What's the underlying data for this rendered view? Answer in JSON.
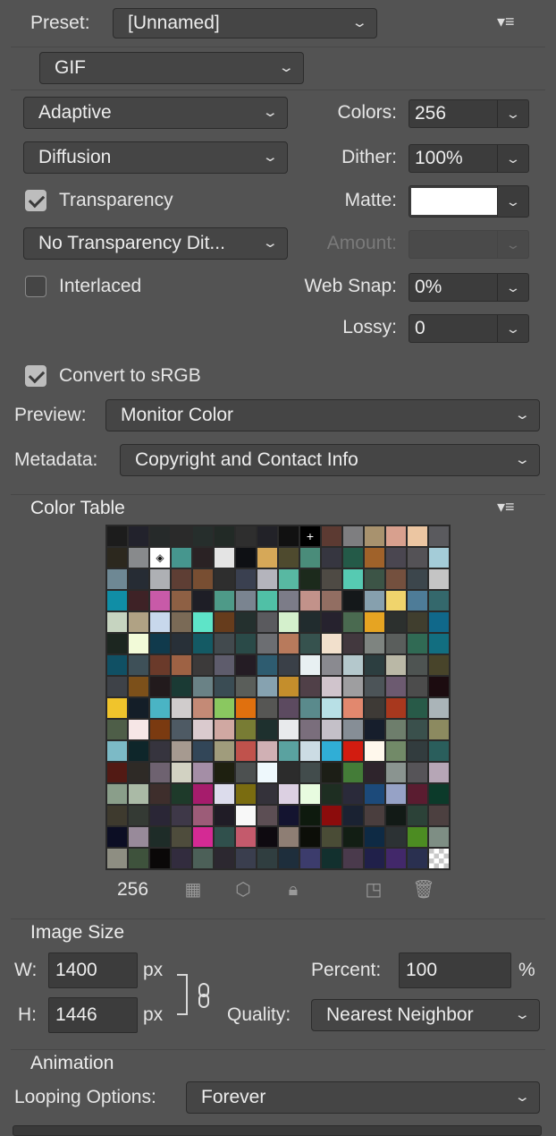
{
  "preset": {
    "label": "Preset:",
    "value": "[Unnamed]"
  },
  "format": {
    "value": "GIF"
  },
  "reduction": {
    "value": "Adaptive"
  },
  "dither_algorithm": {
    "value": "Diffusion"
  },
  "colors": {
    "label": "Colors:",
    "value": "256"
  },
  "dither": {
    "label": "Dither:",
    "value": "100%"
  },
  "transparency": {
    "label": "Transparency",
    "checked": true
  },
  "matte": {
    "label": "Matte:",
    "color": "#ffffff"
  },
  "transparency_dither": {
    "value": "No Transparency Dit..."
  },
  "amount": {
    "label": "Amount:",
    "value": ""
  },
  "interlaced": {
    "label": "Interlaced",
    "checked": false
  },
  "web_snap": {
    "label": "Web Snap:",
    "value": "0%"
  },
  "lossy": {
    "label": "Lossy:",
    "value": "0"
  },
  "convert_srgb": {
    "label": "Convert to sRGB",
    "checked": true
  },
  "preview": {
    "label": "Preview:",
    "value": "Monitor Color"
  },
  "metadata": {
    "label": "Metadata:",
    "value": "Copyright and Contact Info"
  },
  "color_table": {
    "title": "Color Table",
    "count": "256",
    "colors": [
      "#1c1c1c",
      "#22222c",
      "#262a2a",
      "#2a2a2a",
      "#262e2c",
      "#222a26",
      "#2e2e2e",
      "#222228",
      "#111111",
      "#141414",
      "#5c3a32",
      "#7e7e80",
      "#a8926e",
      "#d8a08e",
      "#ecc6a2",
      "#5a5a5e",
      "#2c281e",
      "#888a8c",
      "#ffffff",
      "#46968e",
      "#2a2224",
      "#e4e4e4",
      "#0e1014",
      "#d6a858",
      "#4e4a2e",
      "#4a8c7a",
      "#363640",
      "#245a48",
      "#a0622a",
      "#4a4650",
      "#545256",
      "#a4ccd8",
      "#6e8894",
      "#262c34",
      "#aeb0b4",
      "#5e3e34",
      "#784e32",
      "#2e2e2e",
      "#3a4050",
      "#b4b4bc",
      "#58b8a2",
      "#1c2a1c",
      "#4e4a44",
      "#56cab2",
      "#3c5446",
      "#74503e",
      "#3c464c",
      "#c4c4c4",
      "#108ea6",
      "#3e2226",
      "#c85aa8",
      "#8e6044",
      "#1e1e26",
      "#4e9a88",
      "#7a8490",
      "#50c0a6",
      "#7c7c88",
      "#c2928a",
      "#926e62",
      "#14181a",
      "#86a0ae",
      "#f0d46c",
      "#4e7c98",
      "#34686c",
      "#c6d4c0",
      "#b0a284",
      "#c8d8ec",
      "#7a6a56",
      "#5ee4c8",
      "#663c1c",
      "#24302e",
      "#5a5a5e",
      "#d4f0cc",
      "#212c2e",
      "#26222e",
      "#4a6a50",
      "#e6a422",
      "#2c302e",
      "#403e2e",
      "#10688a",
      "#1c2620",
      "#f2fad8",
      "#103a4c",
      "#283038",
      "#145a64",
      "#424a4e",
      "#2a4a48",
      "#6c6e72",
      "#b87a5c",
      "#36524e",
      "#f2e0cc",
      "#42383e",
      "#7e8480",
      "#5a5e5c",
      "#306a54",
      "#126e80",
      "#105064",
      "#3e5058",
      "#6a3a2a",
      "#9e6244",
      "#3c3a3a",
      "#5e5c6c",
      "#241c24",
      "#2e5c70",
      "#3a4048",
      "#e8f0f2",
      "#8a8a90",
      "#b4c8cc",
      "#2c3e40",
      "#bab8a6",
      "#4e5452",
      "#48442a",
      "#3e4248",
      "#7c501a",
      "#221a1c",
      "#1a3a34",
      "#6a8286",
      "#3a4c54",
      "#5a5e5a",
      "#86a2b0",
      "#c48e2c",
      "#504048",
      "#d0c4cc",
      "#9e9ea0",
      "#4c5458",
      "#6c5a70",
      "#4c4c4c",
      "#1c0c10",
      "#f0c42c",
      "#141e28",
      "#4ab4c4",
      "#d0cccc",
      "#c48a76",
      "#8ac860",
      "#e0700e",
      "#565654",
      "#5c4a60",
      "#5a8a8c",
      "#b8e0e6",
      "#e2886e",
      "#3e3a36",
      "#a8381e",
      "#285a48",
      "#aab4b8",
      "#4e5e48",
      "#f6e6e6",
      "#7a3a10",
      "#4e5a64",
      "#dacace",
      "#d0a8a2",
      "#787c34",
      "#1e302e",
      "#e8eaec",
      "#7a6e7c",
      "#c4c0c8",
      "#868e96",
      "#161e2c",
      "#6e7e6c",
      "#3a504c",
      "#8c8a60",
      "#7cbac6",
      "#0e262a",
      "#36343e",
      "#a69a90",
      "#324658",
      "#a09c7c",
      "#c0524c",
      "#d0b0b4",
      "#5aa2a0",
      "#ccdce4",
      "#30aed6",
      "#d21c10",
      "#fff8ec",
      "#728a68",
      "#323c3e",
      "#2a5e5c",
      "#521a14",
      "#2e2a26",
      "#6e6270",
      "#d2d2c2",
      "#a48ea6",
      "#1e2010",
      "#4c5050",
      "#eef8fc",
      "#2c2c2c",
      "#424c4c",
      "#1c1e16",
      "#447c38",
      "#2e242c",
      "#8a9490",
      "#565458",
      "#b6a6b6",
      "#8a9e8a",
      "#aabaa6",
      "#3e2e2c",
      "#1e3a2a",
      "#a61c6c",
      "#dcdcec",
      "#7a6c10",
      "#34323a",
      "#dcd0e2",
      "#e8fce0",
      "#1e2e22",
      "#2a2a3a",
      "#1c4a7a",
      "#96a2c6",
      "#5a1c30",
      "#0c3a2a",
      "#3e3a2e",
      "#343a34",
      "#2a2636",
      "#3e3848",
      "#9c5c78",
      "#201c26",
      "#f8f8f8",
      "#5c4e54",
      "#141430",
      "#0e1a0e",
      "#8c0c0c",
      "#1a2232",
      "#4a3e3e",
      "#121a16",
      "#2c4238",
      "#4c4040",
      "#0c0e24",
      "#988a9a",
      "#1e2c28",
      "#4e4c3c",
      "#d42a94",
      "#30504c",
      "#c45a6c",
      "#0e0a10",
      "#8e7e74",
      "#0c0e08",
      "#4a4c36",
      "#121e14",
      "#0e2a44",
      "#2c3234",
      "#4c8c22",
      "#7e8e84",
      "#8e8e82",
      "#3e523c",
      "#0a0808",
      "#322c3e",
      "#4c6058",
      "#2c2830",
      "#3a3e4e",
      "#303e40",
      "#1e2e3c",
      "#3c3c6c",
      "#12302e",
      "#4a3a4c",
      "#20204a",
      "#42286a",
      "#2a3050",
      "#checker"
    ]
  },
  "image_size": {
    "title": "Image Size",
    "w_label": "W:",
    "w_value": "1400",
    "w_unit": "px",
    "h_label": "H:",
    "h_value": "1446",
    "h_unit": "px",
    "percent_label": "Percent:",
    "percent_value": "100",
    "percent_unit": "%",
    "quality_label": "Quality:",
    "quality_value": "Nearest Neighbor"
  },
  "animation": {
    "title": "Animation",
    "looping_label": "Looping Options:",
    "looping_value": "Forever"
  }
}
